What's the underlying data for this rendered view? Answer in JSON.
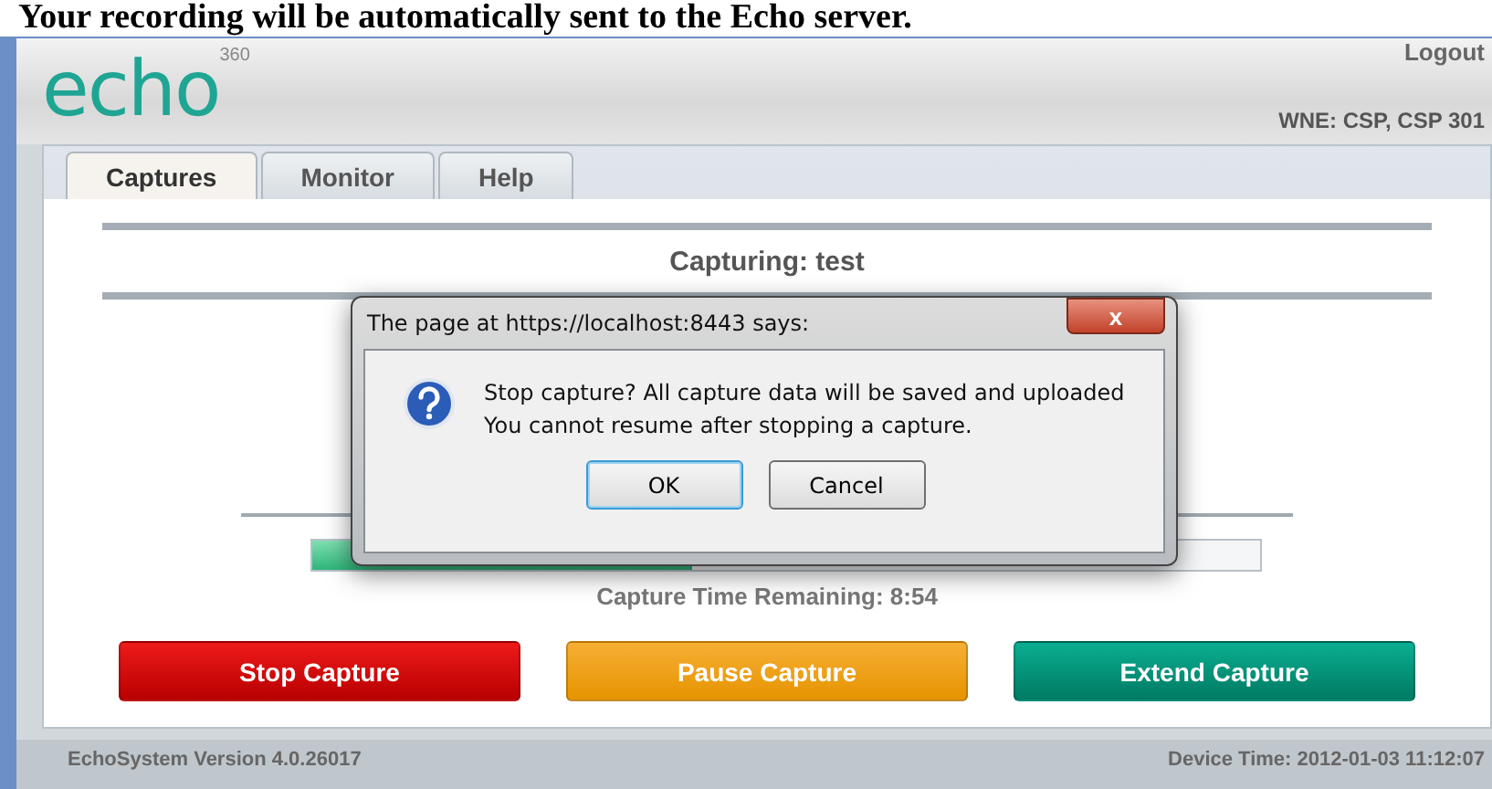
{
  "caption": "Your recording will be automatically sent to the Echo server.",
  "header": {
    "logo": "echo",
    "logo_sup": "360",
    "logout": "Logout",
    "room": "WNE: CSP, CSP 301"
  },
  "tabs": [
    {
      "label": "Captures",
      "selected": true
    },
    {
      "label": "Monitor",
      "selected": false
    },
    {
      "label": "Help",
      "selected": false
    }
  ],
  "capture": {
    "title": "Capturing:  test",
    "progress": {
      "level": 0.4
    },
    "remaining": "Capture Time Remaining: 8:54"
  },
  "buttons": [
    {
      "label": "Stop Capture",
      "kind": "stop"
    },
    {
      "label": "Pause Capture",
      "kind": "pause"
    },
    {
      "label": "Extend Capture",
      "kind": "extend"
    }
  ],
  "dialog": {
    "title": "The page at https://localhost:8443 says:",
    "close": "x",
    "message": [
      "Stop capture? All capture data will be saved and uploaded",
      "You cannot resume after stopping a capture."
    ],
    "buttons": [
      {
        "label": "OK",
        "selected": true
      },
      {
        "label": "Cancel",
        "selected": false
      }
    ]
  },
  "status_bar": {
    "version": "EchoSystem Version 4.0.26017",
    "time": "Device Time: 2012-01-03 11:12:07"
  }
}
